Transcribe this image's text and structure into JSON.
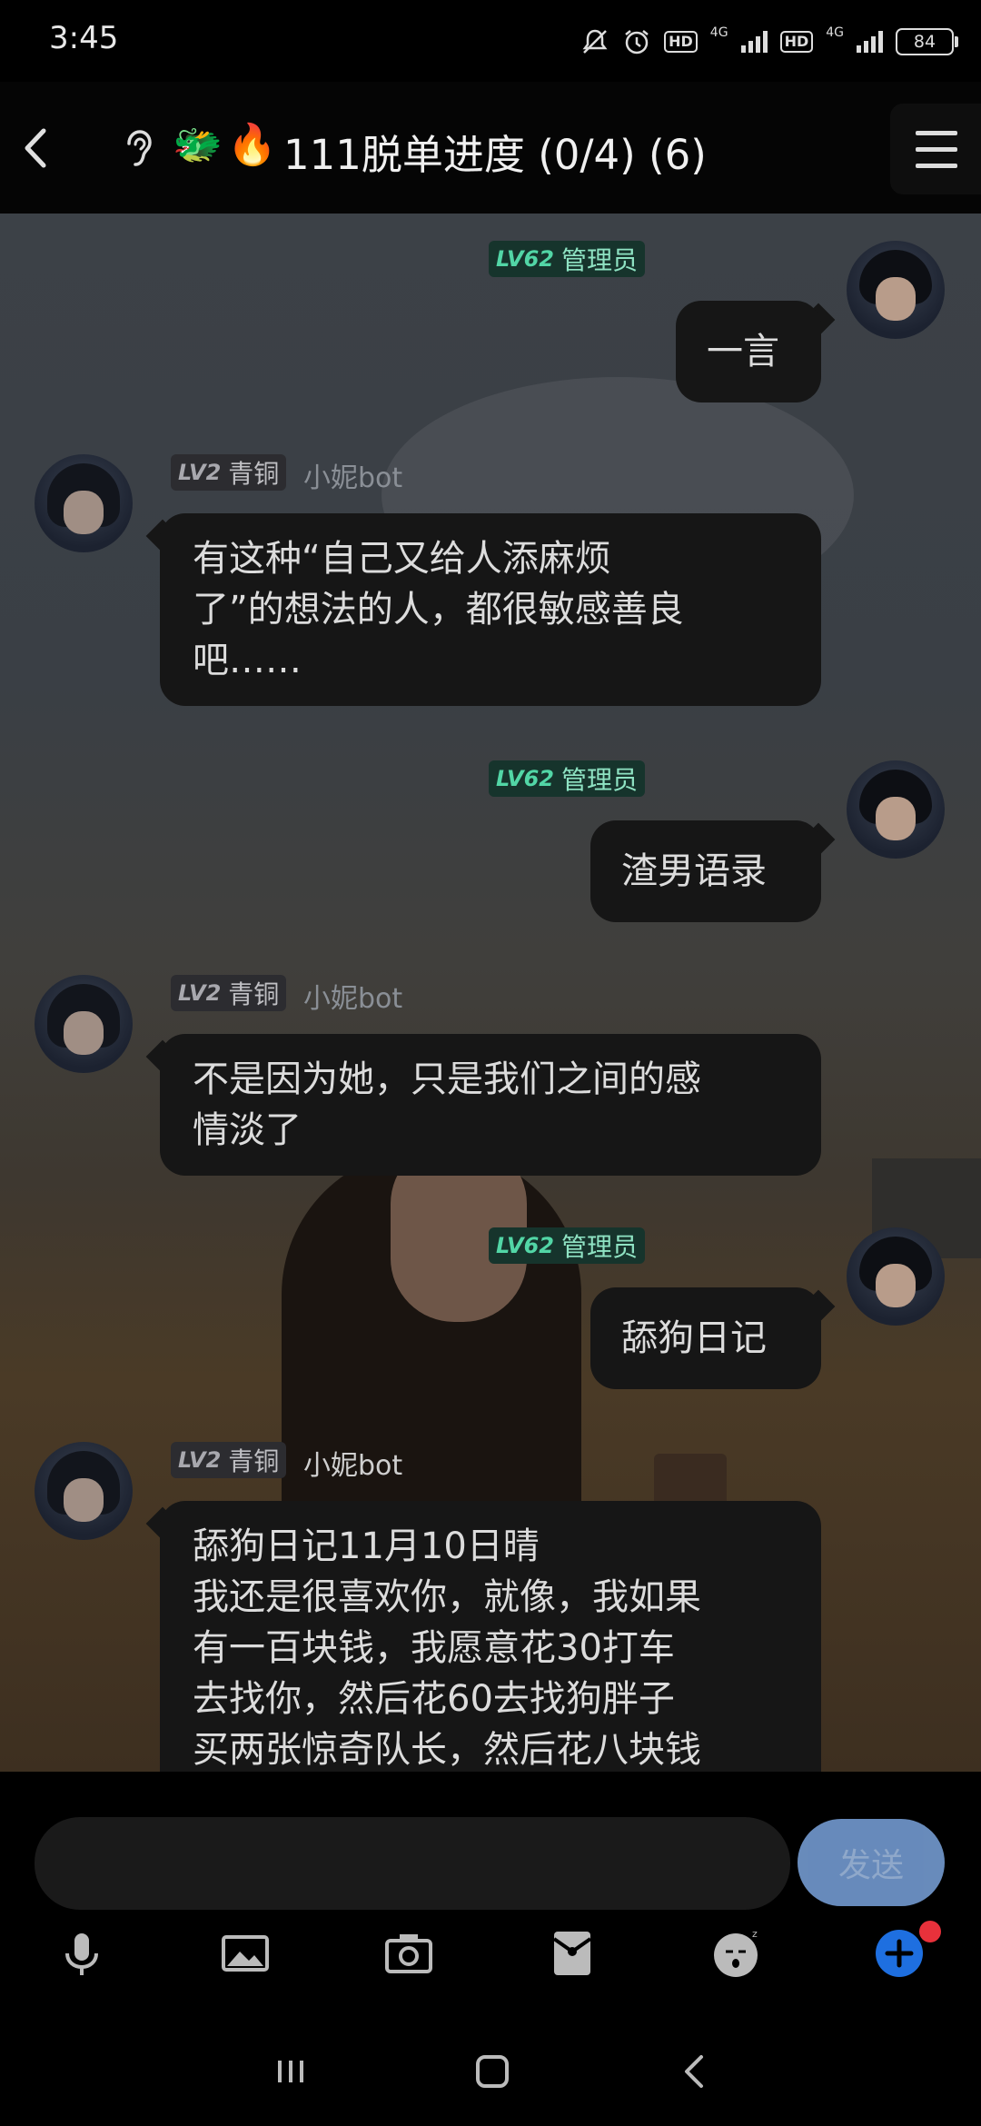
{
  "status_bar": {
    "time": "3:45",
    "hd1": "HD",
    "net1": "4G",
    "hd2": "HD",
    "net2": "4G",
    "battery": "84"
  },
  "header": {
    "back_icon": "chevron-left-icon",
    "ear_icon": "ear-icon",
    "emoji1": "🐲",
    "emoji2": "🔥",
    "title": "111脱单进度 (0/4) (6)",
    "menu_icon": "hamburger-menu-icon"
  },
  "messages": [
    {
      "side": "right",
      "level": "LV62",
      "rank": "管理员",
      "text": "一言"
    },
    {
      "side": "left",
      "level": "LV2",
      "rank": "青铜",
      "sender": "小妮bot",
      "text": "有这种“自己又给人添麻烦了”的想法的人，都很敏感善良吧……"
    },
    {
      "side": "right",
      "level": "LV62",
      "rank": "管理员",
      "text": "渣男语录"
    },
    {
      "side": "left",
      "level": "LV2",
      "rank": "青铜",
      "sender": "小妮bot",
      "text": "不是因为她，只是我们之间的感情淡了"
    },
    {
      "side": "right",
      "level": "LV62",
      "rank": "管理员",
      "text": "舔狗日记"
    },
    {
      "side": "left",
      "level": "LV2",
      "rank": "青铜",
      "sender": "小妮bot",
      "text": "舔狗日记11月10日晴 我还是很喜欢你，就像，我如果有一百块钱，我愿意花30打车去找你，然后花60去找狗胖子买两张惊奇队长，然后花八块钱"
    }
  ],
  "bubble_lines": {
    "m1": [
      "一言"
    ],
    "m2": [
      "有这种“自己又给人添麻烦",
      "了”的想法的人，都很敏感善良",
      "吧……"
    ],
    "m3": [
      "渣男语录"
    ],
    "m4": [
      "不是因为她，只是我们之间的感",
      "情淡了"
    ],
    "m5": [
      "舔狗日记"
    ],
    "m6": [
      "舔狗日记11月10日晴",
      "我还是很喜欢你，就像，我如果",
      "有一百块钱，我愿意花30打车",
      "去找你，然后花60去找狗胖子",
      "买两张惊奇队长，然后花八块钱"
    ]
  },
  "input": {
    "placeholder": "",
    "send_label": "发送"
  },
  "toolbar": [
    "microphone-icon",
    "image-icon",
    "camera-icon",
    "red-packet-icon",
    "emoji-icon",
    "plus-icon"
  ],
  "nav_bar": [
    "recent-apps-icon",
    "home-icon",
    "back-icon"
  ],
  "colors": {
    "admin_badge": "#16342c",
    "admin_text": "#52d6a6",
    "bubble": "#161616",
    "send_button": "#7aa3dc",
    "plus_button": "#1e6fe0",
    "notification_dot": "#e8313b"
  }
}
